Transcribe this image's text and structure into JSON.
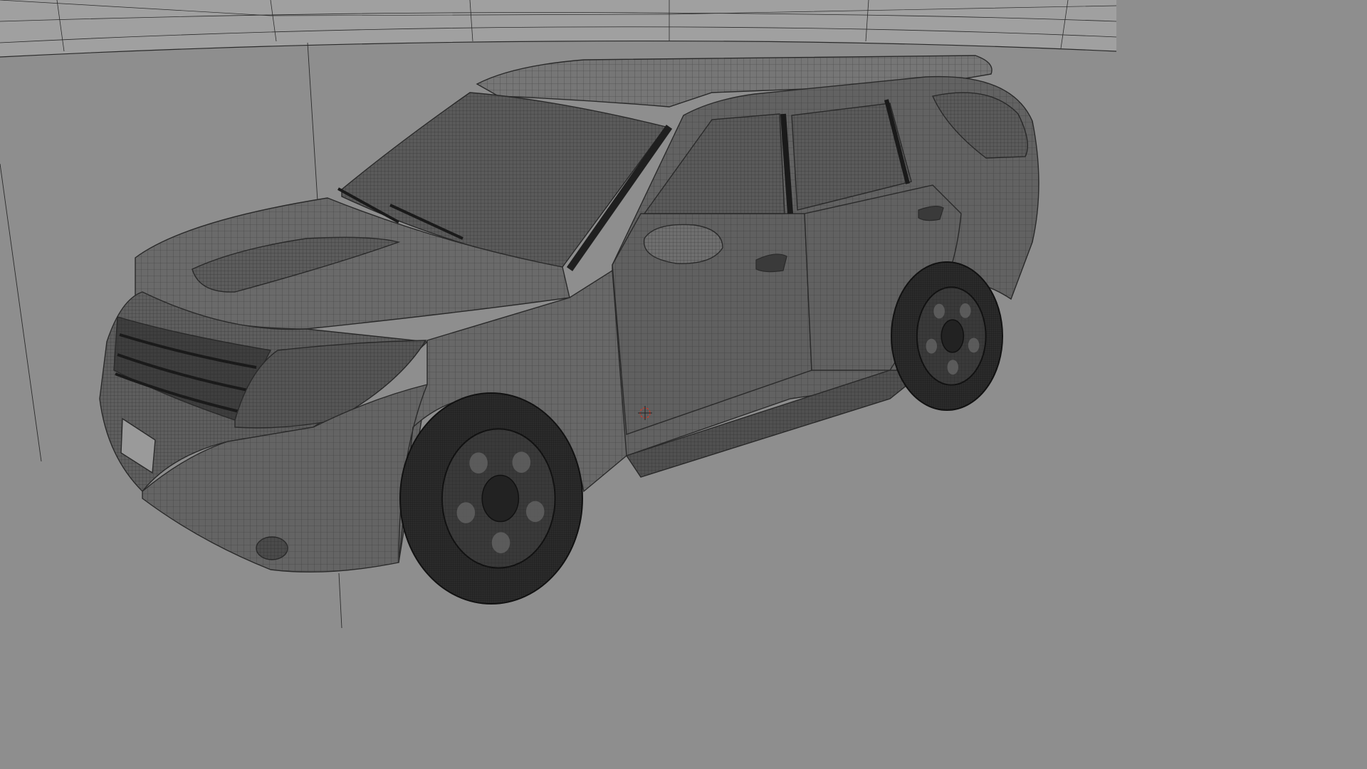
{
  "viewport": {
    "background": "#8e8e8e",
    "cyclorama_color": "#a0a0a0",
    "wire_color": "#2a2a2a",
    "body_color": "#6e6e6e",
    "glass_color": "#5a5a5a",
    "tire_color": "#2b2b2b",
    "rim_color": "#3a3a3a",
    "cursor_color": "#c0392b",
    "shading_mode": "wireframe-on-shaded"
  },
  "scene": {
    "object": "suv-model",
    "icons": [
      "3d-cursor-icon"
    ]
  }
}
